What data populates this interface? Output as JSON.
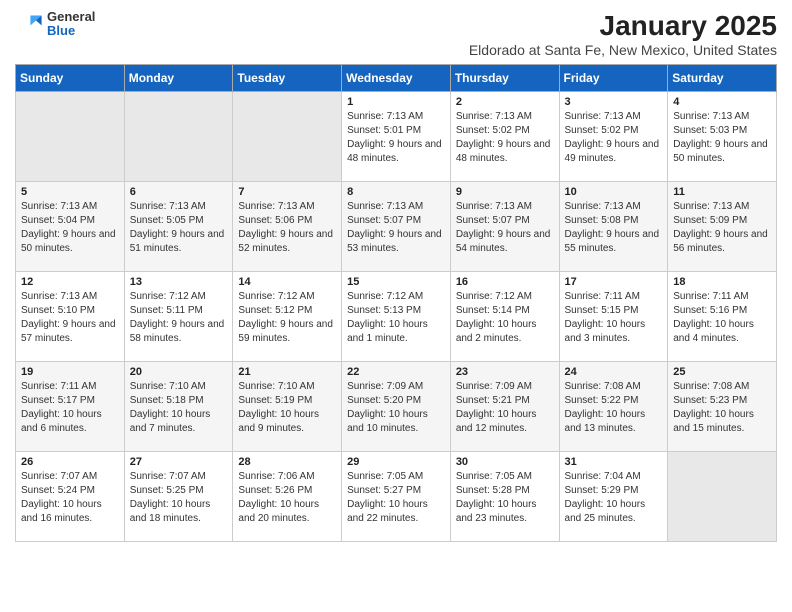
{
  "logo": {
    "general": "General",
    "blue": "Blue"
  },
  "title": "January 2025",
  "subtitle": "Eldorado at Santa Fe, New Mexico, United States",
  "headers": [
    "Sunday",
    "Monday",
    "Tuesday",
    "Wednesday",
    "Thursday",
    "Friday",
    "Saturday"
  ],
  "weeks": [
    [
      {
        "day": "",
        "info": ""
      },
      {
        "day": "",
        "info": ""
      },
      {
        "day": "",
        "info": ""
      },
      {
        "day": "1",
        "info": "Sunrise: 7:13 AM\nSunset: 5:01 PM\nDaylight: 9 hours and 48 minutes."
      },
      {
        "day": "2",
        "info": "Sunrise: 7:13 AM\nSunset: 5:02 PM\nDaylight: 9 hours and 48 minutes."
      },
      {
        "day": "3",
        "info": "Sunrise: 7:13 AM\nSunset: 5:02 PM\nDaylight: 9 hours and 49 minutes."
      },
      {
        "day": "4",
        "info": "Sunrise: 7:13 AM\nSunset: 5:03 PM\nDaylight: 9 hours and 50 minutes."
      }
    ],
    [
      {
        "day": "5",
        "info": "Sunrise: 7:13 AM\nSunset: 5:04 PM\nDaylight: 9 hours and 50 minutes."
      },
      {
        "day": "6",
        "info": "Sunrise: 7:13 AM\nSunset: 5:05 PM\nDaylight: 9 hours and 51 minutes."
      },
      {
        "day": "7",
        "info": "Sunrise: 7:13 AM\nSunset: 5:06 PM\nDaylight: 9 hours and 52 minutes."
      },
      {
        "day": "8",
        "info": "Sunrise: 7:13 AM\nSunset: 5:07 PM\nDaylight: 9 hours and 53 minutes."
      },
      {
        "day": "9",
        "info": "Sunrise: 7:13 AM\nSunset: 5:07 PM\nDaylight: 9 hours and 54 minutes."
      },
      {
        "day": "10",
        "info": "Sunrise: 7:13 AM\nSunset: 5:08 PM\nDaylight: 9 hours and 55 minutes."
      },
      {
        "day": "11",
        "info": "Sunrise: 7:13 AM\nSunset: 5:09 PM\nDaylight: 9 hours and 56 minutes."
      }
    ],
    [
      {
        "day": "12",
        "info": "Sunrise: 7:13 AM\nSunset: 5:10 PM\nDaylight: 9 hours and 57 minutes."
      },
      {
        "day": "13",
        "info": "Sunrise: 7:12 AM\nSunset: 5:11 PM\nDaylight: 9 hours and 58 minutes."
      },
      {
        "day": "14",
        "info": "Sunrise: 7:12 AM\nSunset: 5:12 PM\nDaylight: 9 hours and 59 minutes."
      },
      {
        "day": "15",
        "info": "Sunrise: 7:12 AM\nSunset: 5:13 PM\nDaylight: 10 hours and 1 minute."
      },
      {
        "day": "16",
        "info": "Sunrise: 7:12 AM\nSunset: 5:14 PM\nDaylight: 10 hours and 2 minutes."
      },
      {
        "day": "17",
        "info": "Sunrise: 7:11 AM\nSunset: 5:15 PM\nDaylight: 10 hours and 3 minutes."
      },
      {
        "day": "18",
        "info": "Sunrise: 7:11 AM\nSunset: 5:16 PM\nDaylight: 10 hours and 4 minutes."
      }
    ],
    [
      {
        "day": "19",
        "info": "Sunrise: 7:11 AM\nSunset: 5:17 PM\nDaylight: 10 hours and 6 minutes."
      },
      {
        "day": "20",
        "info": "Sunrise: 7:10 AM\nSunset: 5:18 PM\nDaylight: 10 hours and 7 minutes."
      },
      {
        "day": "21",
        "info": "Sunrise: 7:10 AM\nSunset: 5:19 PM\nDaylight: 10 hours and 9 minutes."
      },
      {
        "day": "22",
        "info": "Sunrise: 7:09 AM\nSunset: 5:20 PM\nDaylight: 10 hours and 10 minutes."
      },
      {
        "day": "23",
        "info": "Sunrise: 7:09 AM\nSunset: 5:21 PM\nDaylight: 10 hours and 12 minutes."
      },
      {
        "day": "24",
        "info": "Sunrise: 7:08 AM\nSunset: 5:22 PM\nDaylight: 10 hours and 13 minutes."
      },
      {
        "day": "25",
        "info": "Sunrise: 7:08 AM\nSunset: 5:23 PM\nDaylight: 10 hours and 15 minutes."
      }
    ],
    [
      {
        "day": "26",
        "info": "Sunrise: 7:07 AM\nSunset: 5:24 PM\nDaylight: 10 hours and 16 minutes."
      },
      {
        "day": "27",
        "info": "Sunrise: 7:07 AM\nSunset: 5:25 PM\nDaylight: 10 hours and 18 minutes."
      },
      {
        "day": "28",
        "info": "Sunrise: 7:06 AM\nSunset: 5:26 PM\nDaylight: 10 hours and 20 minutes."
      },
      {
        "day": "29",
        "info": "Sunrise: 7:05 AM\nSunset: 5:27 PM\nDaylight: 10 hours and 22 minutes."
      },
      {
        "day": "30",
        "info": "Sunrise: 7:05 AM\nSunset: 5:28 PM\nDaylight: 10 hours and 23 minutes."
      },
      {
        "day": "31",
        "info": "Sunrise: 7:04 AM\nSunset: 5:29 PM\nDaylight: 10 hours and 25 minutes."
      },
      {
        "day": "",
        "info": ""
      }
    ]
  ]
}
